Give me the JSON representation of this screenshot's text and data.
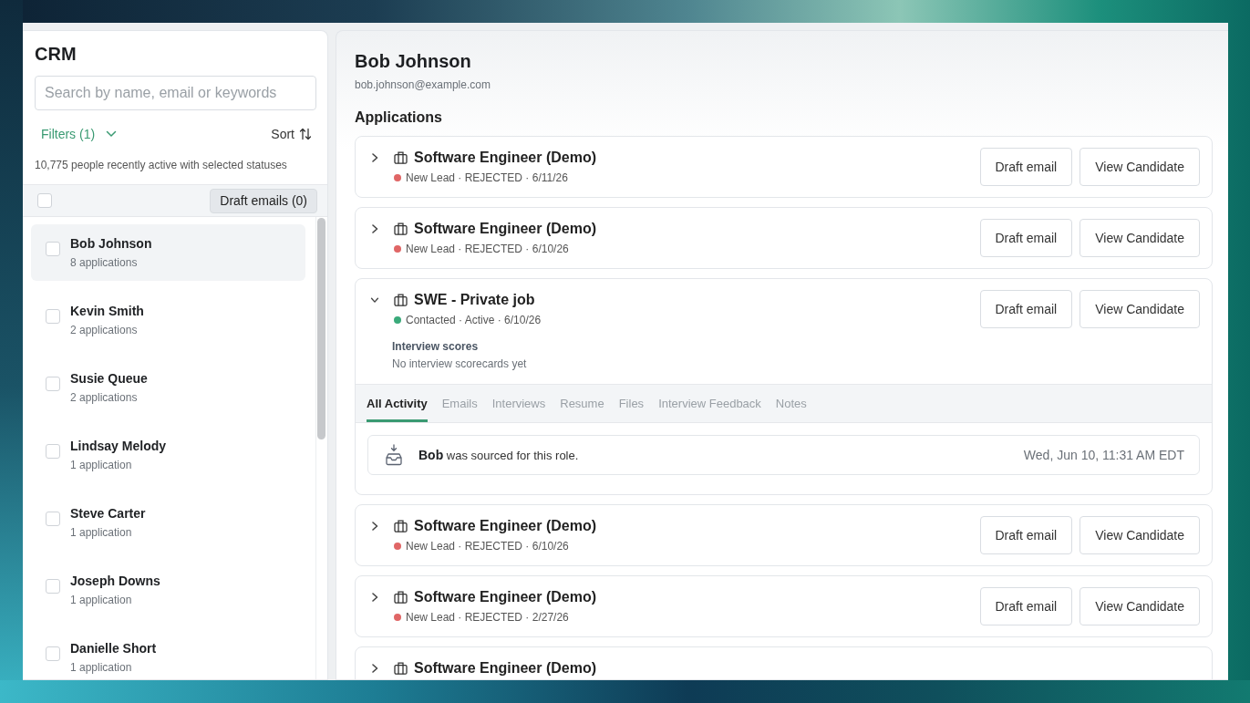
{
  "sidebar": {
    "title": "CRM",
    "search": {
      "placeholder": "Search by name, email or keywords"
    },
    "filters": "Filters (1)",
    "sort": "Sort",
    "summary": "10,775 people recently active with selected statuses",
    "select_all": {
      "checked": false
    },
    "bulk_action": "Draft emails (0)",
    "people": [
      {
        "name": "Bob Johnson",
        "applications": "8 applications",
        "selected": true,
        "checked": false
      },
      {
        "name": "Kevin Smith",
        "applications": "2 applications",
        "selected": false,
        "checked": false
      },
      {
        "name": "Susie Queue",
        "applications": "2 applications",
        "selected": false,
        "checked": false
      },
      {
        "name": "Lindsay Melody",
        "applications": "1 application",
        "selected": false,
        "checked": false
      },
      {
        "name": "Steve Carter",
        "applications": "1 application",
        "selected": false,
        "checked": false
      },
      {
        "name": "Joseph Downs",
        "applications": "1 application",
        "selected": false,
        "checked": false
      },
      {
        "name": "Danielle Short",
        "applications": "1 application",
        "selected": false,
        "checked": false
      }
    ]
  },
  "candidate": {
    "name": "Bob Johnson",
    "email": "bob.johnson@example.com"
  },
  "applications": {
    "heading": "Applications",
    "items": [
      {
        "title": "Software Engineer (Demo)",
        "expanded": false,
        "status_line": "New Lead · REJECTED · 6/11/26",
        "color": "#e06666",
        "actions": [
          "Draft email",
          "View Candidate"
        ]
      },
      {
        "title": "Software Engineer (Demo)",
        "expanded": false,
        "status_line": "New Lead · REJECTED · 6/10/26",
        "color": "#e06666",
        "actions": [
          "Draft email",
          "View Candidate"
        ]
      },
      {
        "title": "SWE - Private job",
        "expanded": true,
        "status_line": "Contacted · Active · 6/10/26",
        "color": "#3aaa7a",
        "actions": [
          "Draft email",
          "View Candidate"
        ],
        "scores": {
          "heading": "Interview scores",
          "text": "No interview scorecards yet"
        },
        "tabs": [
          {
            "label": "All Activity",
            "selected": true
          },
          {
            "label": "Emails",
            "selected": false
          },
          {
            "label": "Interviews",
            "selected": false
          },
          {
            "label": "Resume",
            "selected": false
          },
          {
            "label": "Files",
            "selected": false
          },
          {
            "label": "Interview Feedback",
            "selected": false
          },
          {
            "label": "Notes",
            "selected": false
          }
        ],
        "activity": [
          {
            "text": "**Bob** was sourced for this role.",
            "time": "Wed, Jun 10, 11:31 AM EDT"
          }
        ]
      },
      {
        "title": "Software Engineer (Demo)",
        "expanded": false,
        "status_line": "New Lead · REJECTED · 6/10/26",
        "color": "#e06666",
        "actions": [
          "Draft email",
          "View Candidate"
        ]
      },
      {
        "title": "Software Engineer (Demo)",
        "expanded": false,
        "status_line": "New Lead · REJECTED · 2/27/26",
        "color": "#e06666",
        "actions": [
          "Draft email",
          "View Candidate"
        ]
      },
      {
        "title": "Software Engineer (Demo)",
        "expanded": false
      }
    ]
  }
}
